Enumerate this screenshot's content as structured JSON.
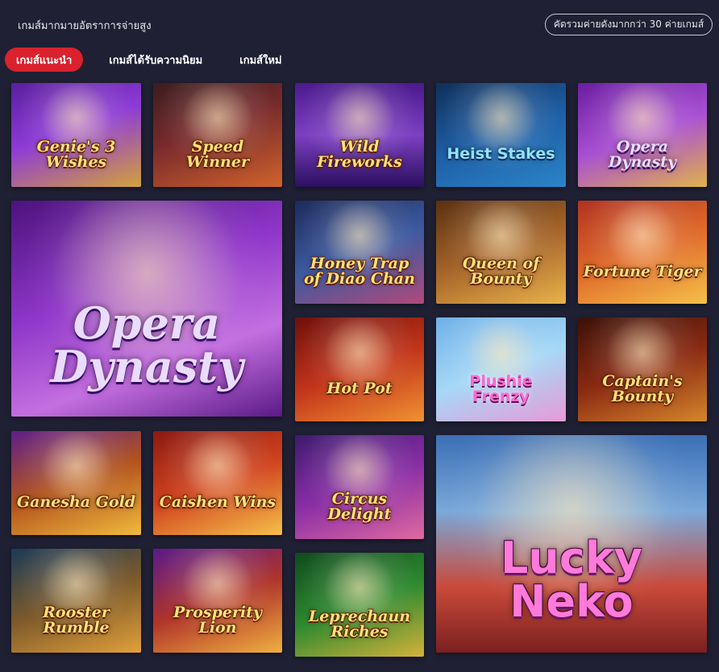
{
  "header": {
    "title": "เกมส์มากมายอัตราการจ่ายสูง",
    "filter_button": "คัดรวมค่ายดังมากกว่า 30 ค่ายเกมส์"
  },
  "tabs": [
    {
      "label": "เกมส์แนะนำ",
      "active": true
    },
    {
      "label": "เกมส์ได้รับความนิยม",
      "active": false
    },
    {
      "label": "เกมส์ใหม่",
      "active": false
    }
  ],
  "games": {
    "genie": "Genie's 3 Wishes",
    "speed": "Speed Winner",
    "fireworks": "Wild Fireworks",
    "heist": "Heist Stakes",
    "opera_small": "Opera Dynasty",
    "opera_big": "Opera Dynasty",
    "diao": "Honey Trap of Diao Chan",
    "queen": "Queen of Bounty",
    "tiger": "Fortune Tiger",
    "hotpot": "Hot Pot",
    "plushie": "Plushie Frenzy",
    "captain": "Captain's Bounty",
    "ganesha": "Ganesha Gold",
    "caishen": "Caishen Wins",
    "circus": "Circus Delight",
    "neko": "Lucky Neko",
    "rooster": "Rooster Rumble",
    "prosperity": "Prosperity Lion",
    "leprechaun": "Leprechaun Riches"
  }
}
